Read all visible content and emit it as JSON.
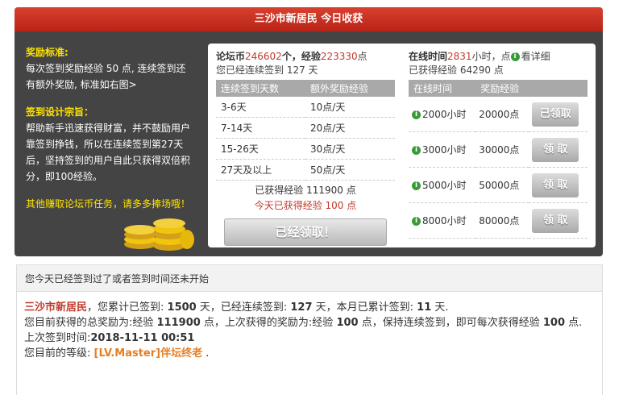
{
  "header": {
    "title": "三沙市新居民 今日收获"
  },
  "left": {
    "reward_title": "奖励标准:",
    "reward_text": "每次签到奖励经验 50 点, 连续签到还有额外奖励, 标准如右图>",
    "design_title": "签到设计宗旨：",
    "design_text": "帮助新手迅速获得财富，并不鼓励用户靠签到挣钱，所以在连续签到第27天后，坚持签到的用户自此只获得双倍积分，即100经验。",
    "other": "其他赚取论坛币任务，请多多捧场哦！"
  },
  "stats": {
    "coins_label": "论坛币",
    "coins_value": "246602",
    "coins_unit": "个，经验",
    "exp_value": "223330",
    "exp_unit": "点",
    "continuous": "您已经连续签到 127 天",
    "online_label": "在线时间",
    "online_value": "2831",
    "online_unit": "小时，点",
    "detail_link": "看详细",
    "earned": "已获得经验 64290 点"
  },
  "reward_table": {
    "headers": [
      "连续签到天数",
      "额外奖励经验"
    ],
    "rows": [
      [
        "3-6天",
        "10点/天"
      ],
      [
        "7-14天",
        "20点/天"
      ],
      [
        "15-26天",
        "30点/天"
      ],
      [
        "27天及以上",
        "50点/天"
      ]
    ],
    "total": "已获得经验 111900 点",
    "today": "今天已获得经验 100 点",
    "button": "已经领取！"
  },
  "online_table": {
    "headers": [
      "在线时间",
      "奖励经验"
    ],
    "rows": [
      {
        "hours": "2000小时",
        "exp": "20000点",
        "button": "已领取"
      },
      {
        "hours": "3000小时",
        "exp": "30000点",
        "button": "领 取"
      },
      {
        "hours": "5000小时",
        "exp": "50000点",
        "button": "领 取"
      },
      {
        "hours": "8000小时",
        "exp": "80000点",
        "button": "领 取"
      }
    ]
  },
  "notice": "您今天已经签到过了或者签到时间还未开始",
  "detail": {
    "name": "三沙市新居民",
    "line1_a": "，您累计已签到: ",
    "total_days": "1500",
    "line1_b": " 天，已经连续签到: ",
    "cont_days": "127",
    "line1_c": " 天，本月已累计签到: ",
    "month_days": "11",
    "line1_d": " 天.",
    "line2_a": "您目前获得的总奖励为:经验 ",
    "total_exp": "111900",
    "line2_b": " 点，上次获得的奖励为:经验 ",
    "last_exp": "100",
    "line2_c": " 点，保持连续签到，即可每次获得经验 ",
    "next_exp": "100",
    "line2_d": " 点.",
    "line3_a": "上次签到时间:",
    "last_time": "2018-11-11 00:51",
    "line4_a": "您目前的等级: ",
    "level": "[LV.Master]伴坛终老",
    "line4_b": " ."
  }
}
